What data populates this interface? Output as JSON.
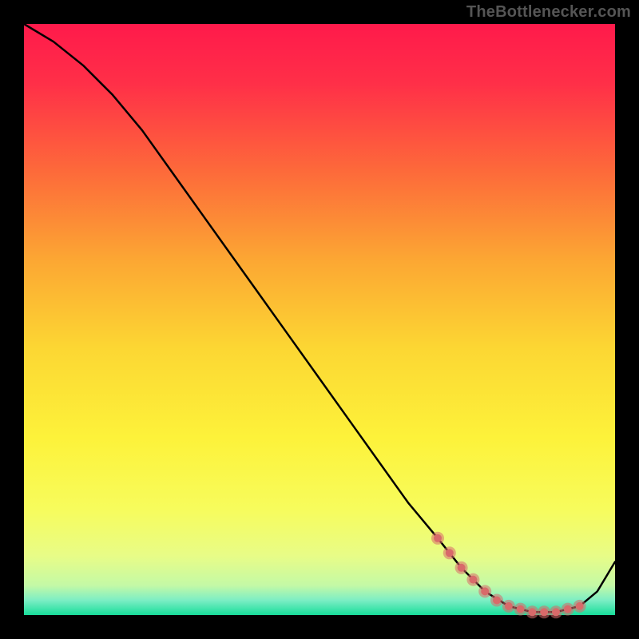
{
  "attribution": "TheBottlenecker.com",
  "chart_data": {
    "type": "line",
    "title": "",
    "xlabel": "",
    "ylabel": "",
    "xlim": [
      0,
      100
    ],
    "ylim": [
      0,
      100
    ],
    "series": [
      {
        "name": "bottleneck-curve",
        "x": [
          0,
          5,
          10,
          15,
          20,
          25,
          30,
          35,
          40,
          45,
          50,
          55,
          60,
          65,
          70,
          74,
          78,
          82,
          86,
          90,
          94,
          97,
          100
        ],
        "y": [
          100,
          97,
          93,
          88,
          82,
          75,
          68,
          61,
          54,
          47,
          40,
          33,
          26,
          19,
          13,
          8,
          4,
          1.5,
          0.5,
          0.5,
          1.5,
          4,
          9
        ]
      }
    ],
    "markers": {
      "name": "highlight-region",
      "x": [
        70,
        72,
        74,
        76,
        78,
        80,
        82,
        84,
        86,
        88,
        90,
        92,
        94
      ],
      "y": [
        13,
        10.5,
        8,
        6,
        4,
        2.5,
        1.5,
        1,
        0.5,
        0.5,
        0.5,
        1,
        1.5
      ]
    },
    "gradient_stops": [
      {
        "offset": 0.0,
        "color": "#ff1a4b"
      },
      {
        "offset": 0.1,
        "color": "#ff2f48"
      },
      {
        "offset": 0.25,
        "color": "#fd6a3a"
      },
      {
        "offset": 0.4,
        "color": "#fca733"
      },
      {
        "offset": 0.55,
        "color": "#fcd733"
      },
      {
        "offset": 0.7,
        "color": "#fdf23a"
      },
      {
        "offset": 0.82,
        "color": "#f7fc5c"
      },
      {
        "offset": 0.9,
        "color": "#e8fc87"
      },
      {
        "offset": 0.95,
        "color": "#c4f9a6"
      },
      {
        "offset": 0.975,
        "color": "#7ceec4"
      },
      {
        "offset": 1.0,
        "color": "#18dd9a"
      }
    ]
  }
}
